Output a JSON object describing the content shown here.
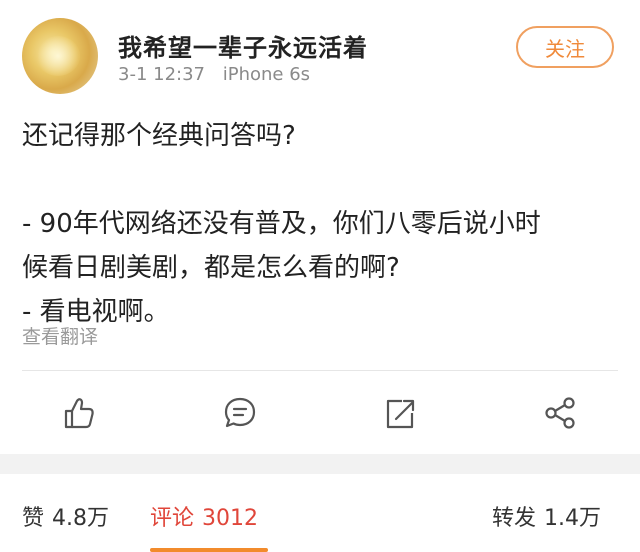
{
  "user": {
    "name": "我希望一辈子永远活着",
    "time": "3-1 12:37",
    "device": "iPhone 6s"
  },
  "follow_label": "关注",
  "post": {
    "line1": "还记得那个经典问答吗?",
    "line2": "- 90年代网络还没有普及，你们八零后说小时",
    "line3": "候看日剧美剧，都是怎么看的啊?",
    "line4": "- 看电视啊。"
  },
  "translate_label": "查看翻译",
  "actions": {
    "like_icon": "thumbs-up-icon",
    "comment_icon": "comment-icon",
    "repost_icon": "share-arrow-icon",
    "share_icon": "share-nodes-icon"
  },
  "stats": {
    "likes_label": "赞",
    "likes_value": "4.8万",
    "comments_label": "评论",
    "comments_value": "3012",
    "reposts_label": "转发",
    "reposts_value": "1.4万"
  },
  "colors": {
    "accent": "#f08a3a",
    "active_tab": "#e0463a",
    "underline": "#f28b2c"
  }
}
